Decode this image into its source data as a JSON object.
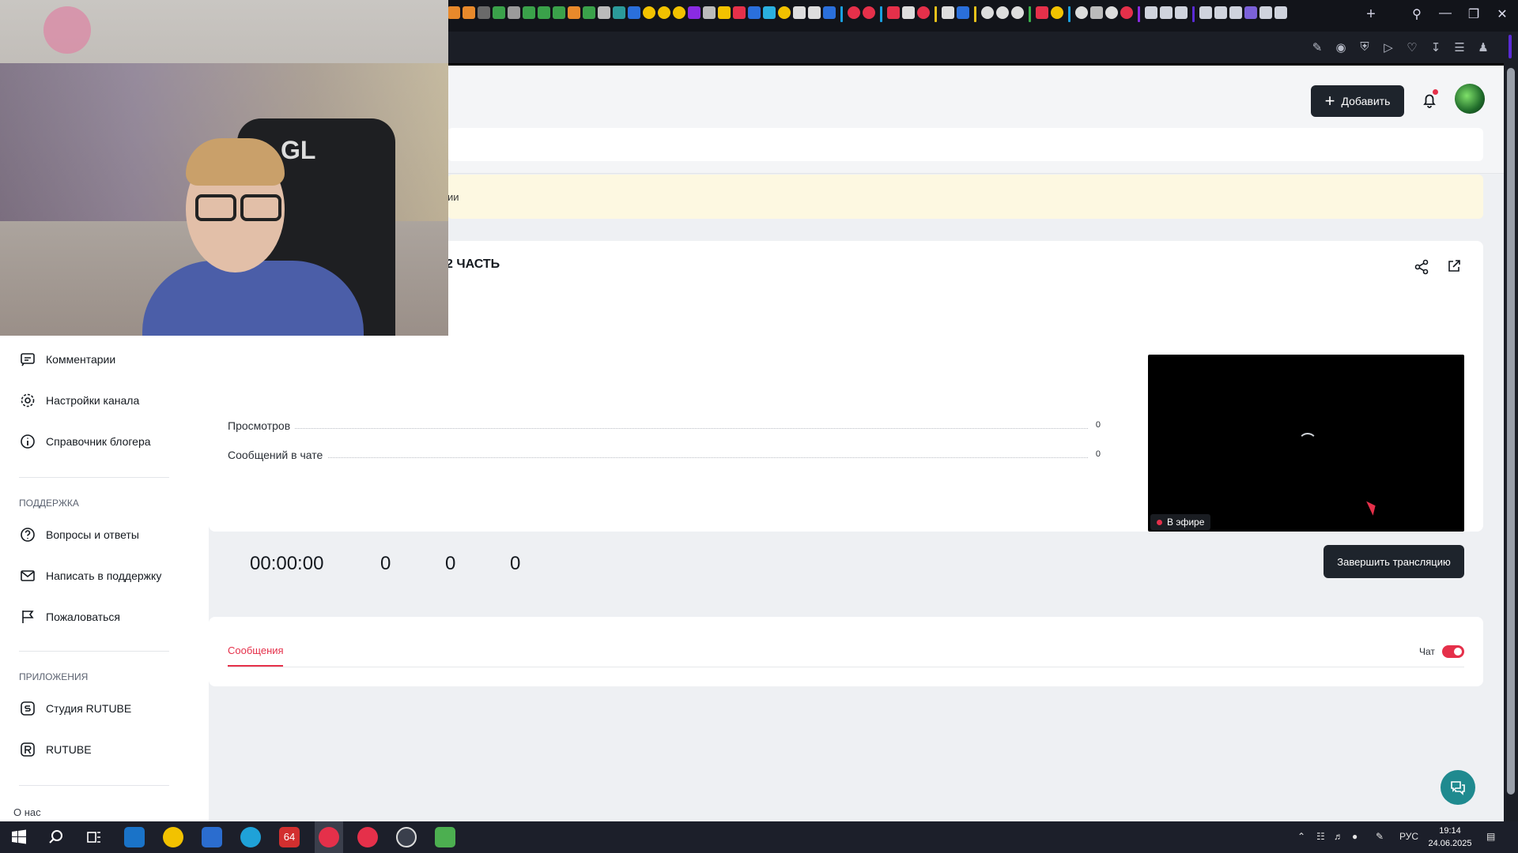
{
  "header": {
    "add_label": "Добавить"
  },
  "notice": {
    "text_fragment": "ии"
  },
  "stream": {
    "title_fragment": "2 ЧАСТЬ",
    "stats": [
      {
        "label": "Просмотров",
        "value": "0"
      },
      {
        "label": "Сообщений в чате",
        "value": "0"
      }
    ],
    "duration": "00:00:00",
    "counter_1": "0",
    "counter_2": "0",
    "counter_3": "0",
    "live_badge": "В эфире",
    "end_button": "Завершить трансляцию"
  },
  "chat": {
    "tab_label": "Сообщения",
    "toggle_label": "Чат",
    "toggle_on": true
  },
  "sidebar": {
    "items": [
      {
        "label": "Комментарии",
        "icon": "comment-icon"
      },
      {
        "label": "Настройки канала",
        "icon": "gear-icon"
      },
      {
        "label": "Справочник блогера",
        "icon": "info-icon"
      }
    ],
    "support_heading": "Поддержка",
    "support_items": [
      {
        "label": "Вопросы и ответы",
        "icon": "question-icon"
      },
      {
        "label": "Написать в поддержку",
        "icon": "mail-icon"
      },
      {
        "label": "Пожаловаться",
        "icon": "flag-icon"
      }
    ],
    "apps_heading": "Приложения",
    "app_items": [
      {
        "label": "Студия RUTUBE",
        "icon": "studio-icon"
      },
      {
        "label": "RUTUBE",
        "icon": "rutube-icon"
      }
    ],
    "about": "О нас"
  },
  "webcam": {
    "chair_logo": "GL"
  },
  "taskbar": {
    "lang": "РУС",
    "time": "19:14",
    "date": "24.06.2025",
    "badge": "64"
  },
  "colors": {
    "accent": "#e5304a",
    "dark_button": "#1e242c",
    "notice_bg": "#fdf8e1",
    "help_fab": "#1f8a8f"
  }
}
